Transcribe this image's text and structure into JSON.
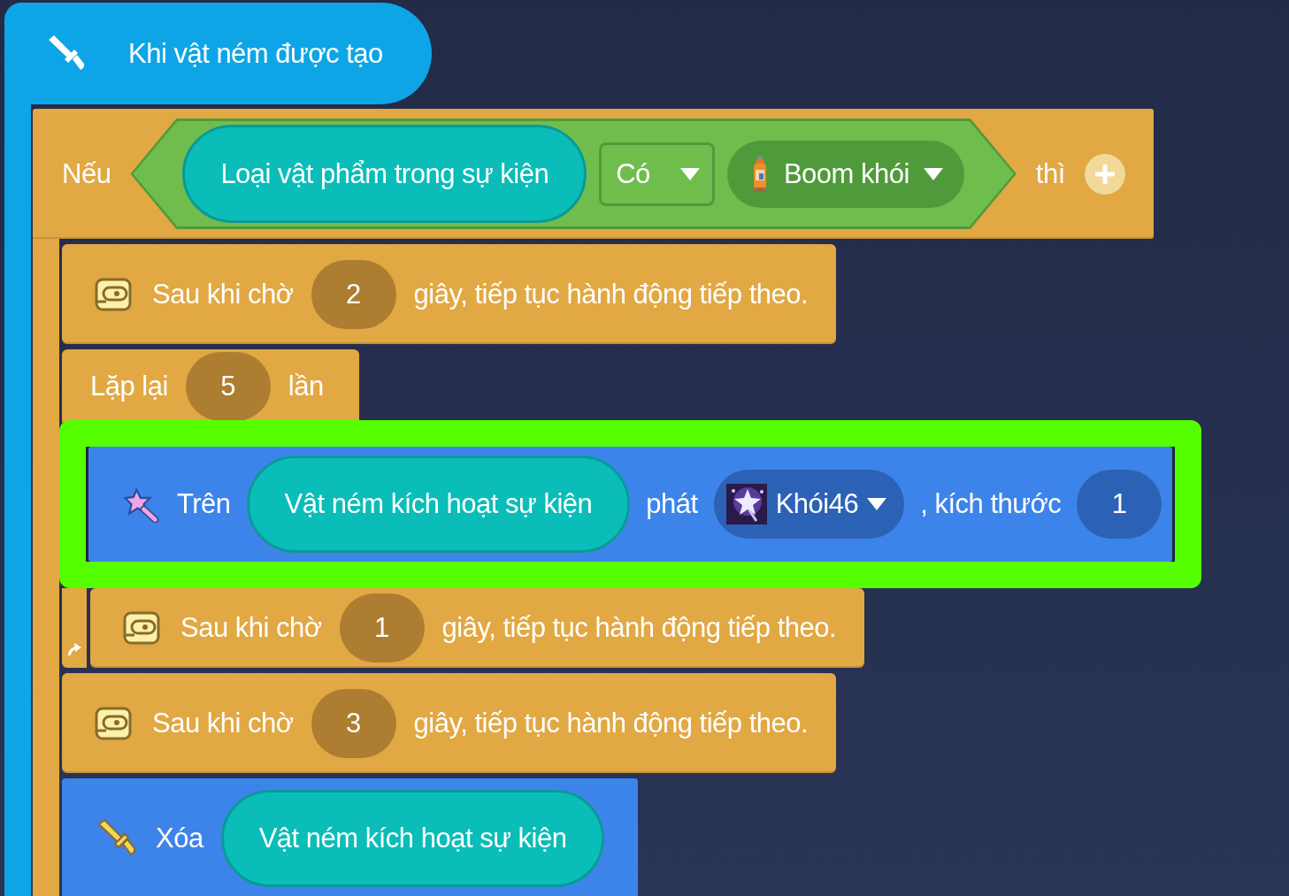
{
  "event_block": {
    "label": "Khi vật ném được tạo"
  },
  "if_block": {
    "label": "Nếu",
    "condition": {
      "subject": "Loại vật phẩm trong sự kiện",
      "operator": "Có",
      "item": "Boom khói"
    },
    "then_label": "thì",
    "body": [
      {
        "kind": "wait",
        "prefix": "Sau khi chờ",
        "seconds": "2",
        "suffix": "giây, tiếp tục hành động tiếp theo."
      },
      {
        "kind": "repeat",
        "prefix": "Lặp lại",
        "count": "5",
        "suffix": "lần",
        "children": [
          {
            "kind": "effect",
            "prefix": "Trên",
            "target": "Vật ném kích hoạt sự kiện",
            "verb": "phát",
            "effect": "Khói46",
            "size_label": ", kích thước",
            "size": "1",
            "highlighted": true
          },
          {
            "kind": "wait",
            "prefix": "Sau khi chờ",
            "seconds": "1",
            "suffix": "giây, tiếp tục hành động tiếp theo.",
            "highlighted": false
          }
        ]
      },
      {
        "kind": "wait",
        "prefix": "Sau khi chờ",
        "seconds": "3",
        "suffix": "giây, tiếp tục hành động tiếp theo."
      },
      {
        "kind": "delete",
        "prefix": "Xóa",
        "target": "Vật ném kích hoạt sự kiện"
      }
    ]
  }
}
